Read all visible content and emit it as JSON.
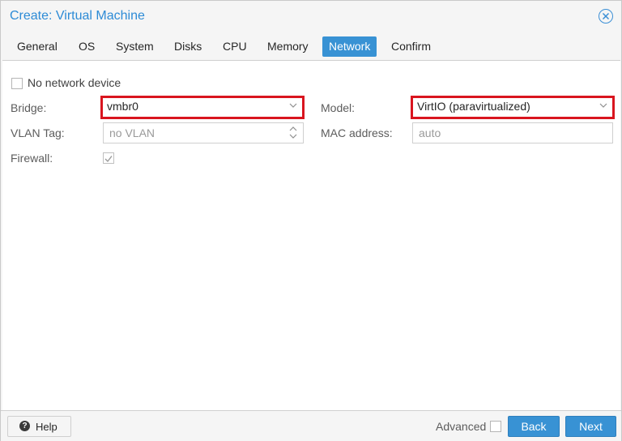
{
  "window": {
    "title": "Create: Virtual Machine"
  },
  "tabs": [
    {
      "label": "General"
    },
    {
      "label": "OS"
    },
    {
      "label": "System"
    },
    {
      "label": "Disks"
    },
    {
      "label": "CPU"
    },
    {
      "label": "Memory"
    },
    {
      "label": "Network",
      "active": true
    },
    {
      "label": "Confirm"
    }
  ],
  "form": {
    "no_network_device": {
      "label": "No network device",
      "checked": false
    },
    "bridge": {
      "label": "Bridge:",
      "value": "vmbr0"
    },
    "model": {
      "label": "Model:",
      "value": "VirtIO (paravirtualized)"
    },
    "vlan_tag": {
      "label": "VLAN Tag:",
      "placeholder": "no VLAN"
    },
    "mac_address": {
      "label": "MAC address:",
      "placeholder": "auto"
    },
    "firewall": {
      "label": "Firewall:",
      "checked": true
    }
  },
  "footer": {
    "help_label": "Help",
    "advanced_label": "Advanced",
    "advanced_checked": false,
    "back_label": "Back",
    "next_label": "Next"
  },
  "colors": {
    "accent": "#3892d4",
    "title": "#2d8bd6",
    "highlight": "#d9151f"
  }
}
